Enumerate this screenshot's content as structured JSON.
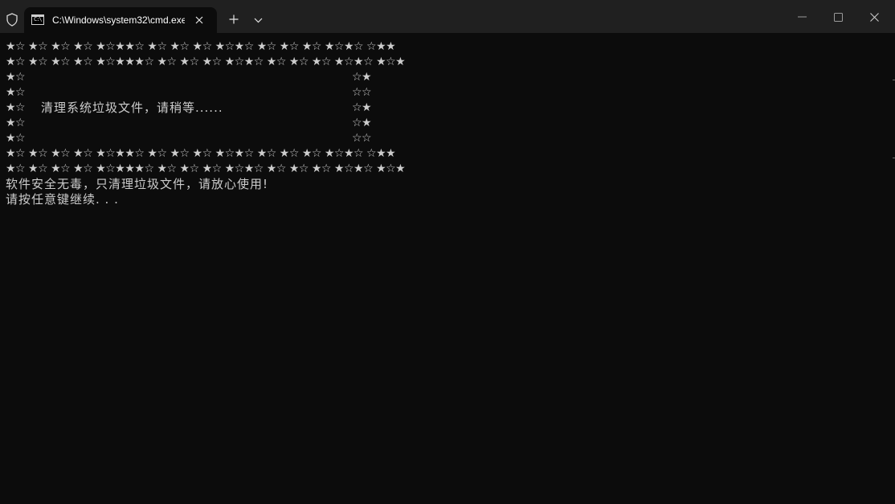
{
  "window": {
    "tab_title": "C:\\Windows\\system32\\cmd.exe",
    "tab_icon_text": "C:\\",
    "colors": {
      "titlebar": "#202020",
      "console_bg": "#0c0c0c",
      "console_fg": "#cccccc",
      "tab_text": "#ffffff"
    }
  },
  "titlebar": {
    "icons": [
      "shield-icon",
      "terminal-icon",
      "close-icon",
      "plus-icon",
      "chevron-down-icon",
      "minimize-icon",
      "maximize-icon",
      "window-close-icon"
    ]
  },
  "console": {
    "border_row": "★☆ ★☆ ★☆ ★☆ ★☆★★☆ ★☆ ★☆ ★☆ ★☆★☆ ★☆ ★☆ ★☆ ★☆★☆ ☆★★",
    "border_row_2": "★☆ ★☆ ★☆ ★☆ ★☆★★★☆ ★☆ ★☆ ★☆ ★☆★☆ ★☆ ★☆ ★☆ ★☆★☆ ★☆★",
    "left_edge_a": "★☆",
    "left_edge_b": "★☆",
    "right_edge_a": "☆★",
    "right_edge_b": "☆☆",
    "message": "清理系统垃圾文件，请稍等......",
    "info_line": "软件安全无毒，只清理垃圾文件，请放心使用!",
    "pause_line": "请按任意键继续. . ."
  }
}
